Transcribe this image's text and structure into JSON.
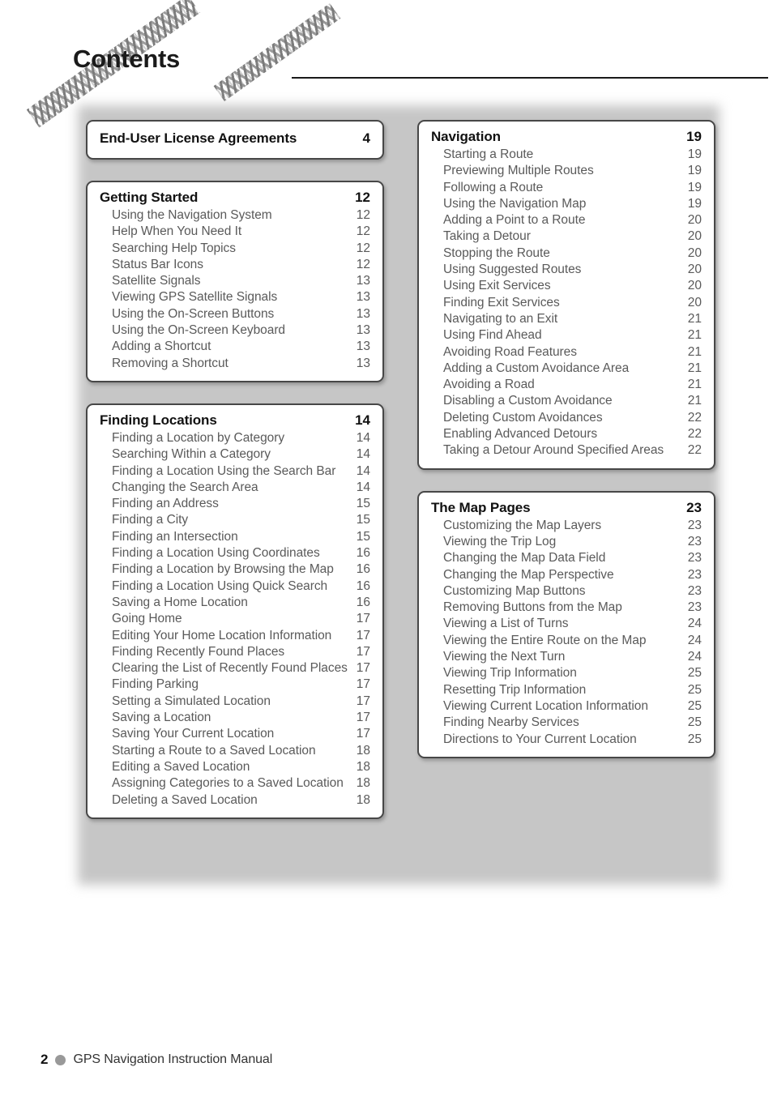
{
  "header": {
    "title": "Contents",
    "decorations": [
      "woven-stripe-long",
      "woven-stripe-short",
      "horizontal-rule"
    ]
  },
  "colors": {
    "panel_gray": "#c6c6c6",
    "box_border": "#474747",
    "box_fill": "#ffffff",
    "heading_text": "#111111",
    "entry_text": "#5a5a5a",
    "footer_bullet": "#999999",
    "rule": "#1a1a1a"
  },
  "columns": {
    "left": [
      {
        "heading": {
          "label": "End-User License Agreements",
          "page": "4"
        },
        "entries": []
      },
      {
        "heading": {
          "label": "Getting Started",
          "page": "12"
        },
        "entries": [
          {
            "label": "Using the Navigation System",
            "page": "12"
          },
          {
            "label": "Help When You Need It",
            "page": "12"
          },
          {
            "label": "Searching Help Topics",
            "page": "12"
          },
          {
            "label": "Status Bar Icons",
            "page": "12"
          },
          {
            "label": "Satellite Signals",
            "page": "13"
          },
          {
            "label": "Viewing GPS Satellite Signals",
            "page": "13"
          },
          {
            "label": "Using the On-Screen Buttons",
            "page": "13"
          },
          {
            "label": "Using the On-Screen Keyboard",
            "page": "13"
          },
          {
            "label": "Adding a Shortcut",
            "page": "13"
          },
          {
            "label": "Removing a Shortcut",
            "page": "13"
          }
        ]
      },
      {
        "heading": {
          "label": "Finding Locations",
          "page": "14"
        },
        "entries": [
          {
            "label": "Finding a Location by Category",
            "page": "14"
          },
          {
            "label": "Searching Within a Category",
            "page": "14"
          },
          {
            "label": "Finding a Location Using the Search Bar",
            "page": "14"
          },
          {
            "label": "Changing the Search Area",
            "page": "14"
          },
          {
            "label": "Finding an Address",
            "page": "15"
          },
          {
            "label": "Finding a City",
            "page": "15"
          },
          {
            "label": "Finding an Intersection",
            "page": "15"
          },
          {
            "label": "Finding a Location Using Coordinates",
            "page": "16"
          },
          {
            "label": "Finding a Location by Browsing the Map",
            "page": "16"
          },
          {
            "label": "Finding a Location Using Quick Search",
            "page": "16"
          },
          {
            "label": "Saving a Home Location",
            "page": "16"
          },
          {
            "label": "Going Home",
            "page": "17"
          },
          {
            "label": "Editing Your Home Location Information",
            "page": "17"
          },
          {
            "label": "Finding Recently Found Places",
            "page": "17"
          },
          {
            "label": "Clearing the List of Recently Found Places",
            "page": "17"
          },
          {
            "label": "Finding Parking",
            "page": "17"
          },
          {
            "label": "Setting a Simulated Location",
            "page": "17"
          },
          {
            "label": "Saving a Location",
            "page": "17"
          },
          {
            "label": "Saving Your Current Location",
            "page": "17"
          },
          {
            "label": "Starting a Route to a Saved Location",
            "page": "18"
          },
          {
            "label": "Editing a Saved Location",
            "page": "18"
          },
          {
            "label": "Assigning Categories to a Saved Location",
            "page": "18"
          },
          {
            "label": "Deleting a Saved Location",
            "page": "18"
          }
        ]
      }
    ],
    "right": [
      {
        "heading": {
          "label": "Navigation",
          "page": "19"
        },
        "entries": [
          {
            "label": "Starting a Route",
            "page": "19"
          },
          {
            "label": "Previewing Multiple Routes",
            "page": "19"
          },
          {
            "label": "Following a Route",
            "page": "19"
          },
          {
            "label": "Using the Navigation Map",
            "page": "19"
          },
          {
            "label": "Adding a Point to a Route",
            "page": "20"
          },
          {
            "label": "Taking a Detour",
            "page": "20"
          },
          {
            "label": "Stopping the Route",
            "page": "20"
          },
          {
            "label": "Using Suggested Routes",
            "page": "20"
          },
          {
            "label": "Using Exit Services",
            "page": "20"
          },
          {
            "label": "Finding Exit Services",
            "page": "20"
          },
          {
            "label": "Navigating to an Exit",
            "page": "21"
          },
          {
            "label": "Using Find Ahead",
            "page": "21"
          },
          {
            "label": "Avoiding Road Features",
            "page": "21"
          },
          {
            "label": "Adding a Custom Avoidance Area",
            "page": "21"
          },
          {
            "label": "Avoiding a Road",
            "page": "21"
          },
          {
            "label": "Disabling a Custom Avoidance",
            "page": "21"
          },
          {
            "label": "Deleting Custom Avoidances",
            "page": "22"
          },
          {
            "label": "Enabling Advanced Detours",
            "page": "22"
          },
          {
            "label": "Taking a Detour Around Specified Areas",
            "page": "22"
          }
        ]
      },
      {
        "heading": {
          "label": "The Map Pages",
          "page": "23"
        },
        "entries": [
          {
            "label": "Customizing the Map Layers",
            "page": "23"
          },
          {
            "label": "Viewing the Trip Log",
            "page": "23"
          },
          {
            "label": "Changing the Map Data Field",
            "page": "23"
          },
          {
            "label": "Changing the Map Perspective",
            "page": "23"
          },
          {
            "label": "Customizing Map Buttons",
            "page": "23"
          },
          {
            "label": "Removing Buttons from the Map",
            "page": "23"
          },
          {
            "label": "Viewing a List of Turns",
            "page": "24"
          },
          {
            "label": "Viewing the Entire Route on the Map",
            "page": "24"
          },
          {
            "label": "Viewing the Next Turn",
            "page": "24"
          },
          {
            "label": "Viewing Trip Information",
            "page": "25"
          },
          {
            "label": "Resetting Trip Information",
            "page": "25"
          },
          {
            "label": "Viewing Current Location Information",
            "page": "25"
          },
          {
            "label": "Finding Nearby Services",
            "page": "25"
          },
          {
            "label": "Directions to Your Current Location",
            "page": "25"
          }
        ]
      }
    ]
  },
  "footer": {
    "page_number": "2",
    "text": "GPS Navigation Instruction Manual"
  }
}
